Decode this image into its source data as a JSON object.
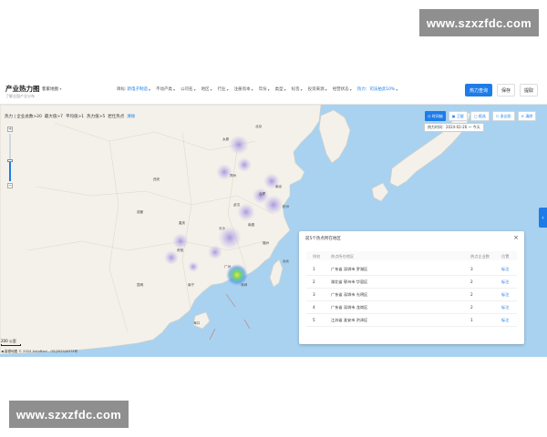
{
  "watermarks": {
    "top": "www.szxzfdc.com",
    "bottom": "www.szxzfdc.com"
  },
  "header": {
    "title": "产业热力图",
    "subtitle": "了解全国产业分布",
    "region": "客家地图",
    "filters": [
      {
        "label": "目标:",
        "value": "新电子制造",
        "active": true
      },
      {
        "label": "不动产类",
        "active": false
      },
      {
        "label": "公司名",
        "active": false
      },
      {
        "label": "地区",
        "active": false
      },
      {
        "label": "行业",
        "active": false
      },
      {
        "label": "注册资本",
        "active": false
      },
      {
        "label": "年份",
        "active": false
      },
      {
        "label": "类型",
        "active": false
      },
      {
        "label": "标签",
        "active": false
      },
      {
        "label": "投资来源",
        "active": false
      },
      {
        "label": "经营状态",
        "active": false
      },
      {
        "label": "热力：司法拍卖10%",
        "active": true
      }
    ],
    "buttons": {
      "primary": "热力查询",
      "save": "保存",
      "export": "提取"
    }
  },
  "stats": {
    "items": [
      "热力 | 企业总数>20",
      "最大值>7",
      "平均值>1",
      "热力值>5",
      "岩仕热点"
    ],
    "clear": "清除"
  },
  "toolbar": {
    "items": [
      "时间轴",
      "卫星",
      "框选",
      "多边形",
      "清除"
    ]
  },
  "time_filter": "热力时间：2024-02-26 ～ 今天",
  "panel": {
    "title": "前5个热点所在地区",
    "close": "×",
    "columns": [
      "排名",
      "热点所在地区",
      "热点企业数",
      "位置"
    ],
    "rows": [
      {
        "rank": "1",
        "region": "广东省 深圳市 罗湖区",
        "count": "3",
        "action": "标注"
      },
      {
        "rank": "2",
        "region": "湖北省 鄂州市 华容区",
        "count": "2",
        "action": "标注"
      },
      {
        "rank": "3",
        "region": "广东省 深圳市 光明区",
        "count": "2",
        "action": "标注"
      },
      {
        "rank": "4",
        "region": "广东省 深圳市 龙岗区",
        "count": "2",
        "action": "标注"
      },
      {
        "rank": "5",
        "region": "江苏省 淮安市 洪泽区",
        "count": "1",
        "action": "标注"
      }
    ]
  },
  "map": {
    "scale": "200 公里",
    "copyright": "◀ 高德地图  © 2024 AutoNavi - GS(2021)6375号",
    "city_labels": [
      "太原",
      "北京",
      "郑州",
      "合肥",
      "武汉",
      "南京",
      "杭州",
      "长沙",
      "南昌",
      "福州",
      "贵阳",
      "重庆",
      "南宁",
      "广州",
      "深圳",
      "昆明",
      "西安",
      "成都",
      "海口",
      "台北"
    ]
  },
  "colors": {
    "accent": "#1e7ce8",
    "sea": "#a9d2f0",
    "land": "#f3f1ea"
  }
}
